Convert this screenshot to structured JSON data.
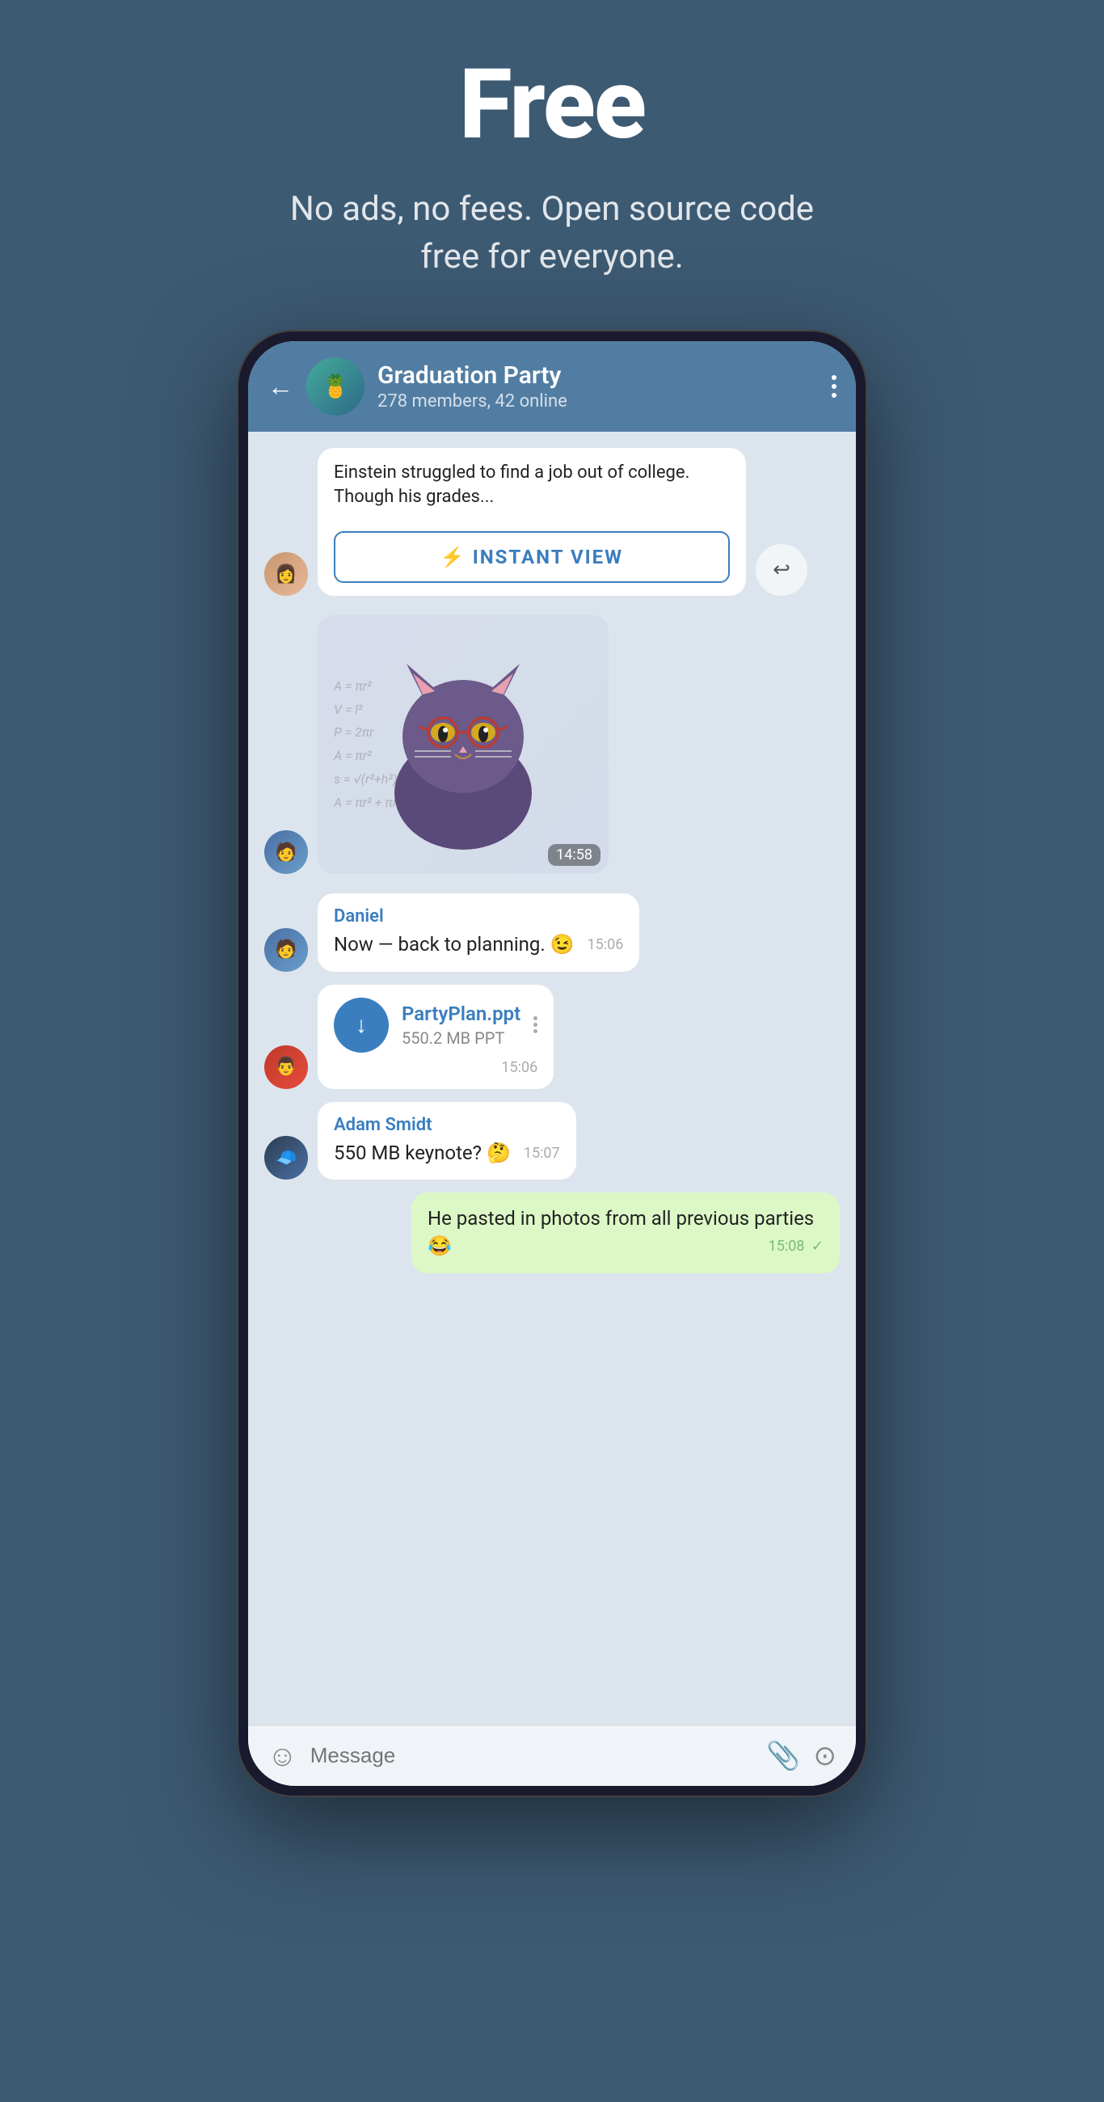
{
  "hero": {
    "title": "Free",
    "subtitle": "No ads, no fees. Open source code free for everyone."
  },
  "phone": {
    "header": {
      "back_label": "←",
      "group_name": "Graduation Party",
      "group_members": "278 members, 42 online",
      "more_label": "⋮",
      "group_emoji": "🍍"
    },
    "messages": [
      {
        "id": "article_msg",
        "type": "article",
        "avatar": "girl",
        "article_text": "Einstein struggled to find a job out of college. Though his grades...",
        "instant_view_label": "INSTANT VIEW"
      },
      {
        "id": "sticker_msg",
        "type": "sticker",
        "avatar": "boy",
        "sticker": "🐱",
        "time": "14:58"
      },
      {
        "id": "daniel_msg",
        "type": "text",
        "avatar": "boy",
        "sender": "Daniel",
        "text": "Now — back to planning. 😉",
        "time": "15:06"
      },
      {
        "id": "file_msg",
        "type": "file",
        "avatar": "guy2",
        "file_name": "PartyPlan.ppt",
        "file_size": "550.2 MB PPT",
        "time": "15:06"
      },
      {
        "id": "adam_msg",
        "type": "text",
        "avatar": "guy3",
        "sender": "Adam Smidt",
        "text": "550 MB keynote? 🤔",
        "time": "15:07"
      },
      {
        "id": "my_msg",
        "type": "own",
        "text": "He pasted in photos from all previous parties 😂",
        "time": "15:08",
        "check": "✓"
      }
    ],
    "input": {
      "placeholder": "Message",
      "emoji_icon": "☺",
      "attach_icon": "📎",
      "camera_icon": "⊙"
    }
  }
}
